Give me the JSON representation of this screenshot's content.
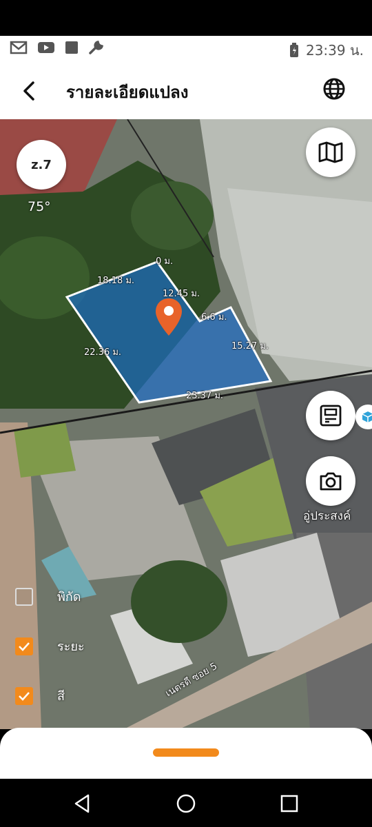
{
  "status": {
    "time": "23:39 น."
  },
  "header": {
    "title": "รายละเอียดแปลง"
  },
  "map": {
    "zoom_label": "z.7",
    "tilt_label": "75°",
    "place_label": "อู่ประสงค์",
    "road_label": "เนตรดี ซอย 5",
    "dimensions": {
      "d1": "0 ม.",
      "d2": "18.18 ม.",
      "d3": "12.45 ม.",
      "d4": "6.6 ม.",
      "d5": "15.27 ม.",
      "d6": "22.36 ม.",
      "d7": "23.37 ม."
    },
    "parcel_color": "#1a6fd0",
    "pin_color": "#e8632a"
  },
  "layers": [
    {
      "label": "พิกัด",
      "checked": false
    },
    {
      "label": "ระยะ",
      "checked": true
    },
    {
      "label": "สี",
      "checked": true
    }
  ],
  "accent": "#f28a1c",
  "icons": [
    "gmail-icon",
    "youtube-icon",
    "app-icon",
    "wrench-icon",
    "battery-icon",
    "back-arrow-icon",
    "globe-icon",
    "map-icon",
    "save-icon",
    "camera-icon",
    "cube-icon",
    "location-pin-icon",
    "nav-back-icon",
    "nav-home-icon",
    "nav-recents-icon"
  ]
}
